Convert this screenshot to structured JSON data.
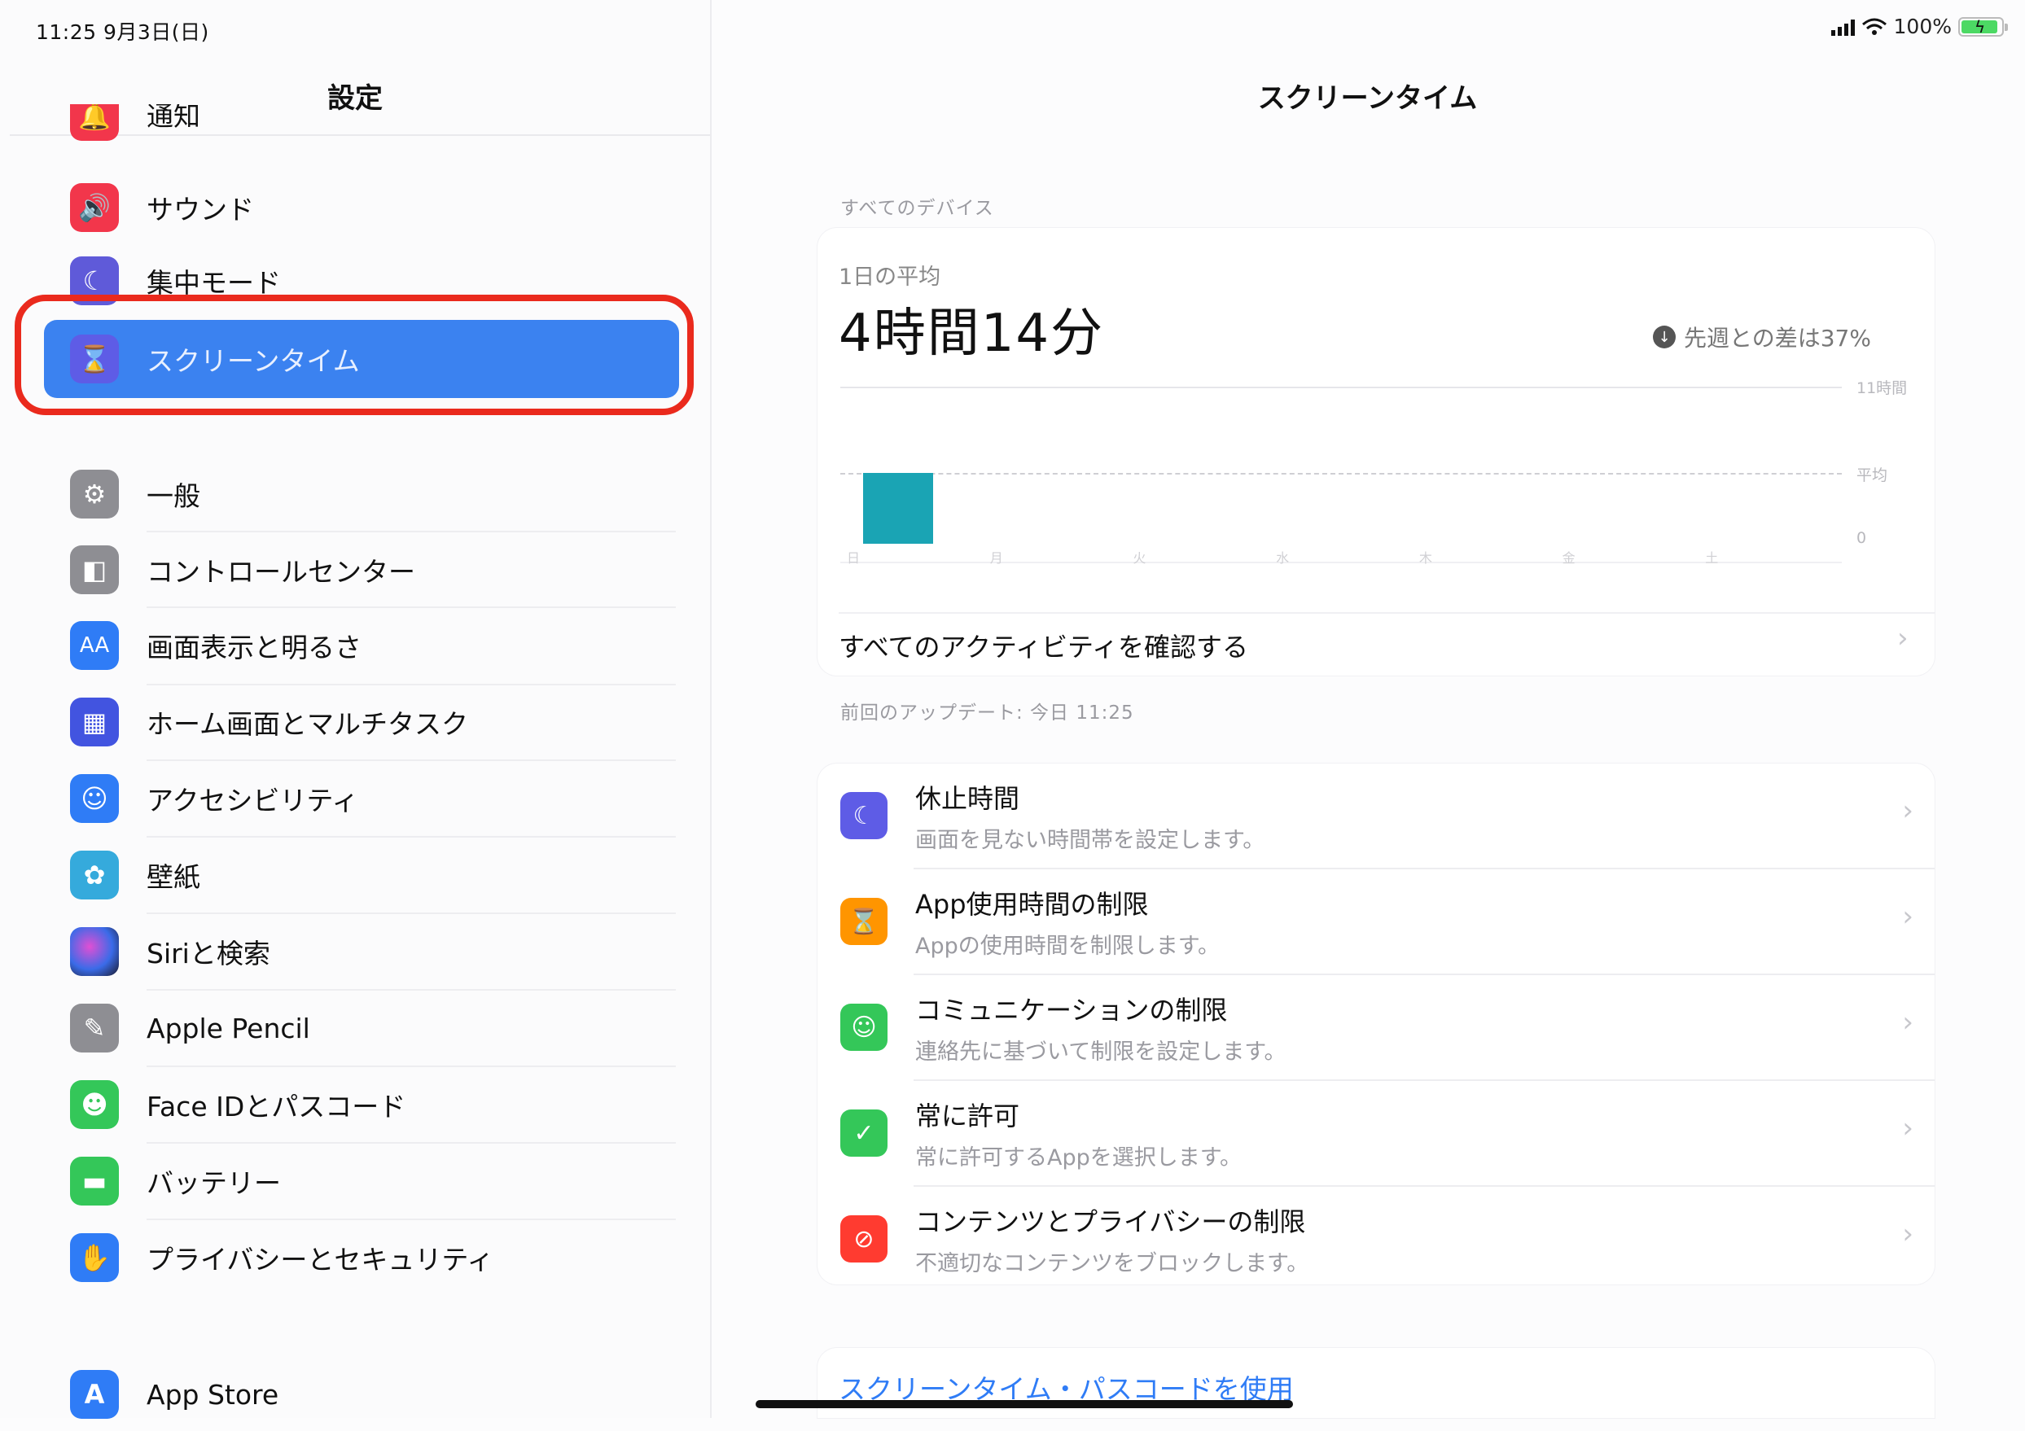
{
  "status_bar": {
    "time": "11:25  9月3日(日)",
    "battery": "100%",
    "battery_level": 1.0,
    "icons": [
      "cellular-signal-icon",
      "wifi-icon",
      "battery-charging-icon"
    ]
  },
  "sidebar": {
    "title": "設定",
    "partial_item": "通知",
    "group1": [
      {
        "label": "サウンド",
        "icon": "speaker-icon",
        "color": "#f2364b",
        "glyph": "🔊"
      },
      {
        "label": "集中モード",
        "icon": "moon-icon",
        "color": "#5f5ad9",
        "glyph": "☾"
      },
      {
        "label": "スクリーンタイム",
        "icon": "hourglass-icon",
        "color": "#5e5ce6",
        "glyph": "⌛"
      }
    ],
    "group2": [
      {
        "label": "一般",
        "icon": "gear-icon",
        "color": "#8e8e93",
        "glyph": "⚙"
      },
      {
        "label": "コントロールセンター",
        "icon": "toggles-icon",
        "color": "#8e8e93",
        "glyph": "◧"
      },
      {
        "label": "画面表示と明るさ",
        "icon": "text-size-icon",
        "color": "#2f7cf6",
        "glyph": "AA"
      },
      {
        "label": "ホーム画面とマルチタスク",
        "icon": "app-grid-icon",
        "color": "#4254e0",
        "glyph": "▦"
      },
      {
        "label": "アクセシビリティ",
        "icon": "accessibility-icon",
        "color": "#2f7cf6",
        "glyph": "☺"
      },
      {
        "label": "壁紙",
        "icon": "flower-icon",
        "color": "#35aadc",
        "glyph": "✿"
      },
      {
        "label": "Siriと検索",
        "icon": "siri-icon",
        "color": "#2b2b44",
        "glyph": "◉"
      },
      {
        "label": "Apple Pencil",
        "icon": "pencil-icon",
        "color": "#8e8e93",
        "glyph": "✎"
      },
      {
        "label": "Face IDとパスコード",
        "icon": "face-id-icon",
        "color": "#34c759",
        "glyph": "☻"
      },
      {
        "label": "バッテリー",
        "icon": "battery-icon",
        "color": "#34c759",
        "glyph": "▬"
      },
      {
        "label": "プライバシーとセキュリティ",
        "icon": "hand-icon",
        "color": "#2f7cf6",
        "glyph": "✋"
      }
    ],
    "group3": [
      {
        "label": "App Store",
        "icon": "app-store-icon",
        "color": "#2f7cf6",
        "glyph": "A"
      }
    ]
  },
  "main": {
    "title": "スクリーンタイム",
    "devices_caption": "すべてのデバイス",
    "summary": {
      "avg_label": "1日の平均",
      "avg_value": "4時間14分",
      "comparison": "先週との差は37%",
      "comparison_icon": "arrow-down-circle-icon",
      "axis_max": "11時間",
      "avg_marker": "平均",
      "axis_zero": "0"
    },
    "chart_data": {
      "type": "bar",
      "categories": [
        "日",
        "月",
        "火",
        "水",
        "木",
        "金",
        "土"
      ],
      "values": [
        4.23,
        0,
        0,
        0,
        0,
        0,
        0
      ],
      "avg_line": 4.23,
      "ylim": [
        0,
        11
      ],
      "color": "#1aa4b4"
    },
    "see_all": "すべてのアクティビティを確認する",
    "updated_caption": "前回のアップデート: 今日 11:25",
    "options": [
      {
        "title": "休止時間",
        "sub": "画面を見ない時間帯を設定します。",
        "icon": "downtime-moon-icon",
        "color": "#5e5ce6",
        "glyph": "☾"
      },
      {
        "title": "App使用時間の制限",
        "sub": "Appの使用時間を制限します。",
        "icon": "hourglass-icon",
        "color": "#ff9500",
        "glyph": "⌛"
      },
      {
        "title": "コミュニケーションの制限",
        "sub": "連絡先に基づいて制限を設定します。",
        "icon": "contact-icon",
        "color": "#34c759",
        "glyph": "☺"
      },
      {
        "title": "常に許可",
        "sub": "常に許可するAppを選択します。",
        "icon": "checkmark-shield-icon",
        "color": "#34c759",
        "glyph": "✓"
      },
      {
        "title": "コンテンツとプライバシーの制限",
        "sub": "不適切なコンテンツをブロックします。",
        "icon": "restriction-icon",
        "color": "#ff3b30",
        "glyph": "⊘"
      }
    ],
    "passcode_link": "スクリーンタイム・パスコードを使用"
  }
}
